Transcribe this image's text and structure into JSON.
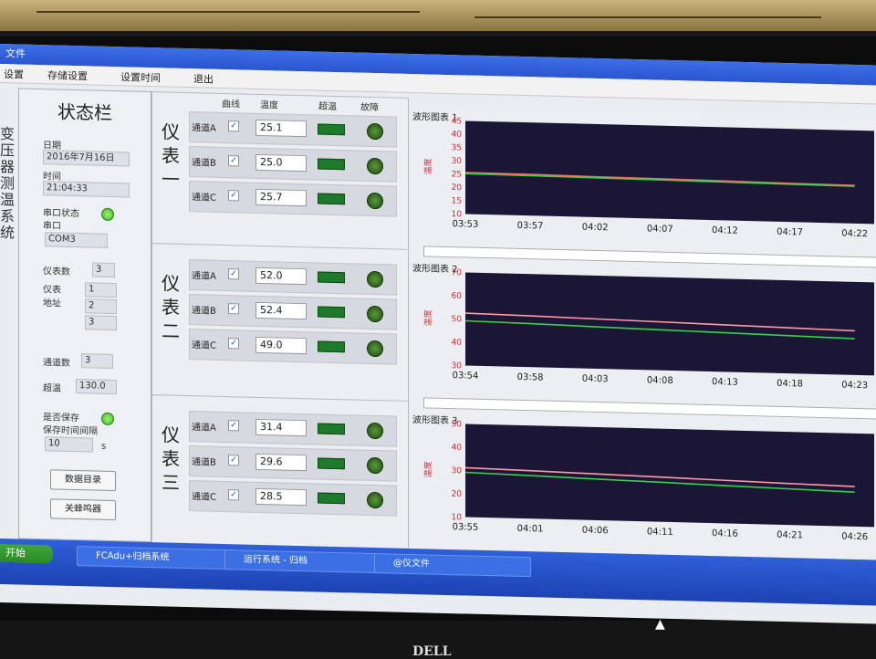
{
  "window": {
    "title": "文件"
  },
  "menu": [
    "设置",
    "存储设置",
    "设置时间",
    "退出"
  ],
  "left_vertical_text": "变压器测温系统",
  "status": {
    "title": "状态栏",
    "date_label": "日期",
    "date_value": "2016年7月16日",
    "time_label": "时间",
    "time_value": "21:04:33",
    "serial_status_label": "串口状态",
    "serial_label": "串口",
    "serial_value": "COM3",
    "meter_count_label": "仪表数",
    "meter_count_value": "3",
    "meter_addr_label": "仪表地址",
    "meter_addrs": [
      "1",
      "2",
      "3"
    ],
    "channel_count_label": "通道数",
    "channel_count_value": "3",
    "overtemp_label": "超温",
    "overtemp_value": "130.0",
    "save_label": "是否保存",
    "save_interval_label": "保存时间间隔",
    "save_interval_value": "10",
    "save_interval_unit": "s",
    "btn_data_dir": "数据目录",
    "btn_close_buzzer": "关蜂鸣器"
  },
  "columns": {
    "curve": "曲线",
    "temp": "温度",
    "overtemp": "超温",
    "fault": "故障"
  },
  "meters": [
    {
      "label": "仪表一",
      "channels": [
        {
          "name": "通道A",
          "value": "25.1"
        },
        {
          "name": "通道B",
          "value": "25.0"
        },
        {
          "name": "通道C",
          "value": "25.7"
        }
      ]
    },
    {
      "label": "仪表二",
      "channels": [
        {
          "name": "通道A",
          "value": "52.0"
        },
        {
          "name": "通道B",
          "value": "52.4"
        },
        {
          "name": "通道C",
          "value": "49.0"
        }
      ]
    },
    {
      "label": "仪表三",
      "channels": [
        {
          "name": "通道A",
          "value": "31.4"
        },
        {
          "name": "通道B",
          "value": "29.6"
        },
        {
          "name": "通道C",
          "value": "28.5"
        }
      ]
    }
  ],
  "chart_data": [
    {
      "type": "line",
      "title": "波形图表 1",
      "ylabel": "温度",
      "ylim": [
        10,
        45
      ],
      "yticks": [
        10,
        15,
        20,
        25,
        30,
        35,
        40,
        45
      ],
      "x": [
        "03:53",
        "03:57",
        "04:02",
        "04:07",
        "04:12",
        "04:17",
        "04:22"
      ],
      "series": [
        {
          "color": "#ff6a6a",
          "values": [
            25.6,
            25.5,
            25.2,
            25.0,
            24.8,
            24.5,
            24.3
          ]
        },
        {
          "color": "#38d24a",
          "values": [
            25.2,
            25.0,
            24.8,
            24.6,
            24.4,
            24.2,
            24.0
          ]
        }
      ]
    },
    {
      "type": "line",
      "title": "波形图表 2",
      "ylabel": "温度",
      "ylim": [
        30,
        70
      ],
      "yticks": [
        30,
        40,
        50,
        60,
        70
      ],
      "x": [
        "03:54",
        "03:58",
        "04:03",
        "04:08",
        "04:13",
        "04:18",
        "04:23"
      ],
      "series": [
        {
          "color": "#ff9aa6",
          "values": [
            52.5,
            52.0,
            51.4,
            50.8,
            50.2,
            49.6,
            49.0
          ]
        },
        {
          "color": "#38d24a",
          "values": [
            49.2,
            48.7,
            48.0,
            47.4,
            46.8,
            46.2,
            45.6
          ]
        }
      ]
    },
    {
      "type": "line",
      "title": "波形图表 3",
      "ylabel": "温度",
      "ylim": [
        10,
        50
      ],
      "yticks": [
        10,
        20,
        30,
        40,
        50
      ],
      "x": [
        "03:55",
        "04:01",
        "04:06",
        "04:11",
        "04:16",
        "04:21",
        "04:26"
      ],
      "series": [
        {
          "color": "#ff9aa6",
          "values": [
            31.2,
            30.6,
            29.9,
            29.2,
            28.5,
            27.8,
            27.2
          ]
        },
        {
          "color": "#38d24a",
          "values": [
            29.2,
            28.5,
            27.7,
            27.0,
            26.2,
            25.5,
            24.8
          ]
        }
      ]
    }
  ],
  "taskbar": {
    "start": "开始",
    "tasks": [
      "FCAdu+归档系统",
      "运行系统 - 归档",
      "@仪文件"
    ]
  },
  "brand": "DELL"
}
